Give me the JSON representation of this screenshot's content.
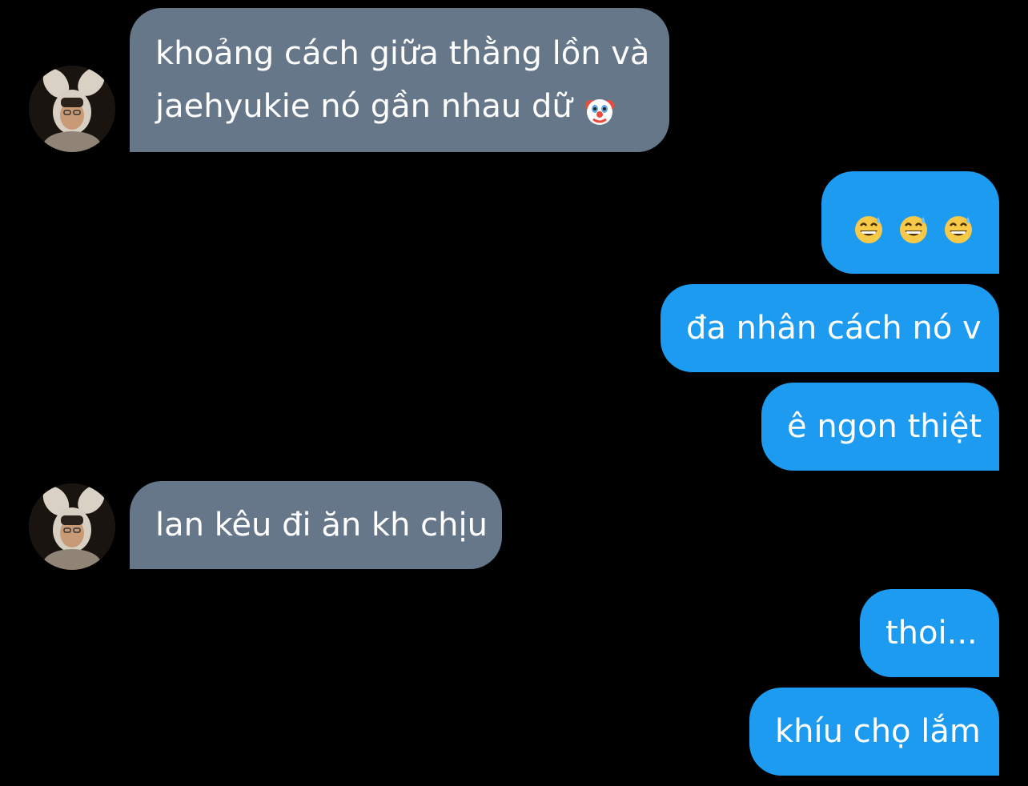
{
  "conversation": {
    "messages": [
      {
        "from": "other",
        "lines": [
          "khoảng cách giữa thằng lồn và",
          "jaehyukie nó gần nhau dữ"
        ],
        "emoji": "clown-face-icon"
      },
      {
        "from": "me",
        "emoji": [
          "grinning-sweat-icon",
          "grinning-sweat-icon",
          "grinning-sweat-icon"
        ]
      },
      {
        "from": "me",
        "text": "đa nhân cách nó v"
      },
      {
        "from": "me",
        "text": "ê ngon thiệt"
      },
      {
        "from": "other",
        "text": "lan kêu đi ăn kh chịu"
      },
      {
        "from": "me",
        "text": "thoi..."
      },
      {
        "from": "me",
        "text": "khíu chọ lắm"
      }
    ]
  },
  "colors": {
    "background": "#000000",
    "incoming_bubble": "#66778a",
    "outgoing_bubble": "#1d9bf0",
    "text": "#ffffff"
  }
}
